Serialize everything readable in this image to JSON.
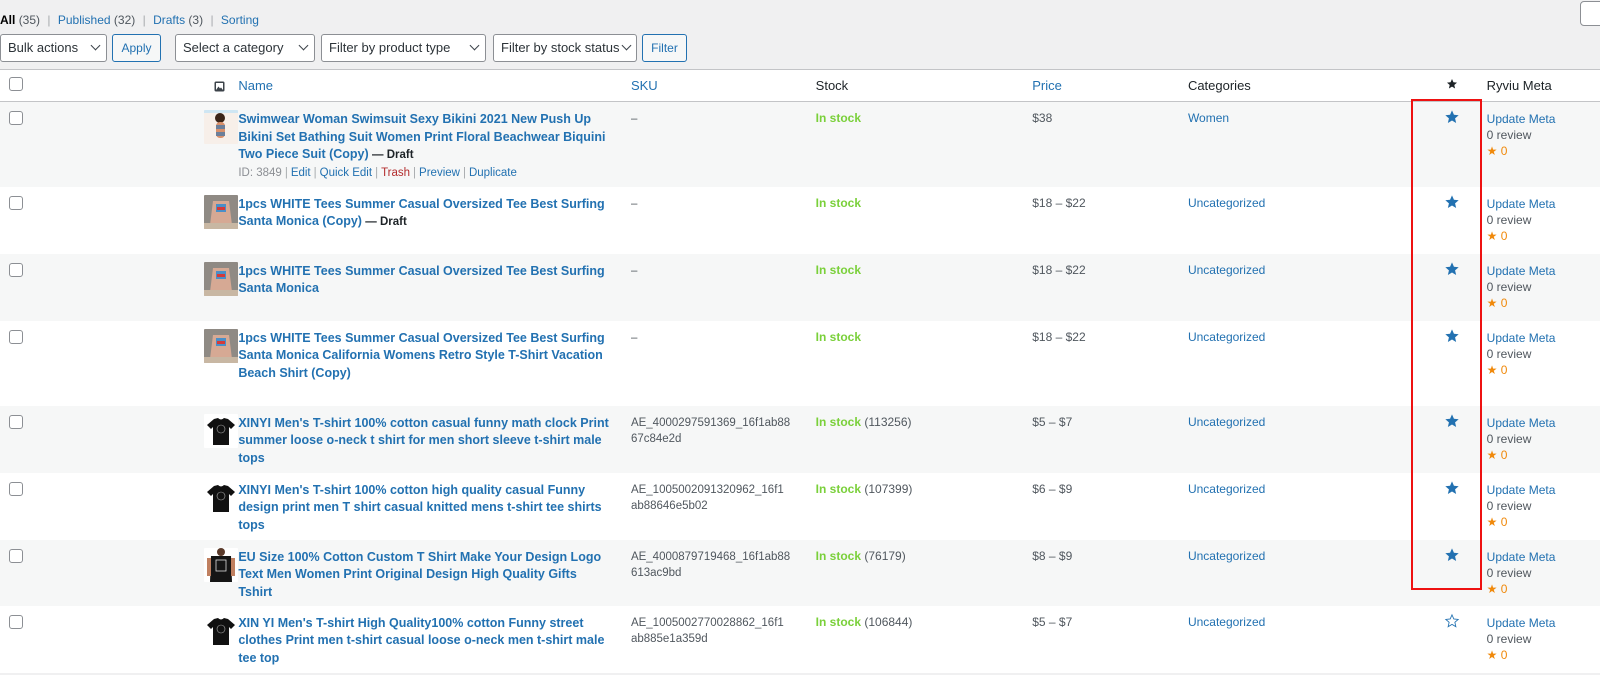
{
  "views": {
    "all": {
      "label": "All",
      "count": "(35)"
    },
    "published": {
      "label": "Published",
      "count": "(32)"
    },
    "drafts": {
      "label": "Drafts",
      "count": "(3)"
    },
    "sorting": {
      "label": "Sorting"
    },
    "separator": "|"
  },
  "toolbar": {
    "bulk_actions": "Bulk actions",
    "apply": "Apply",
    "category": "Select a category",
    "product_type": "Filter by product type",
    "stock_status": "Filter by stock status",
    "filter": "Filter"
  },
  "columns": {
    "name": "Name",
    "sku": "SKU",
    "stock": "Stock",
    "price": "Price",
    "categories": "Categories",
    "featured_icon": "star-icon",
    "ryviu": "Ryviu Meta"
  },
  "colors": {
    "link": "#2271b1",
    "in_stock": "#7ad03a",
    "trash": "#b32d2e",
    "rating_star": "#f0890b",
    "highlight_box": "#ee1111"
  },
  "row_actions": {
    "id": "ID: 3849",
    "edit": "Edit",
    "quick_edit": "Quick Edit",
    "trash": "Trash",
    "preview": "Preview",
    "duplicate": "Duplicate",
    "sep": "|"
  },
  "products": [
    {
      "name": "Swimwear Woman Swimsuit Sexy Bikini 2021 New Push Up Bikini Set Bathing Suit Women Print Floral Beachwear Biquini Two Piece Suit (Copy)",
      "status": "— Draft",
      "sku": "–",
      "stock": "In stock",
      "qty": "",
      "price": "$38",
      "category": "Women",
      "featured": true,
      "update": "Update Meta",
      "reviews": "0 review",
      "rating": "★ 0",
      "thumb": "bikini"
    },
    {
      "name": "1pcs WHITE Tees Summer Casual Oversized Tee Best Surfing Santa Monica (Copy)",
      "status": "— Draft",
      "sku": "–",
      "stock": "In stock",
      "qty": "",
      "price": "$18 – $22",
      "category": "Uncategorized",
      "featured": true,
      "update": "Update Meta",
      "reviews": "0 review",
      "rating": "★ 0",
      "thumb": "tee"
    },
    {
      "name": "1pcs WHITE Tees Summer Casual Oversized Tee Best Surfing Santa Monica",
      "status": "",
      "sku": "–",
      "stock": "In stock",
      "qty": "",
      "price": "$18 – $22",
      "category": "Uncategorized",
      "featured": true,
      "update": "Update Meta",
      "reviews": "0 review",
      "rating": "★ 0",
      "thumb": "tee"
    },
    {
      "name": "1pcs WHITE Tees Summer Casual Oversized Tee Best Surfing Santa Monica California Womens Retro Style T-Shirt Vacation Beach Shirt (Copy)",
      "status": "",
      "sku": "–",
      "stock": "In stock",
      "qty": "",
      "price": "$18 – $22",
      "category": "Uncategorized",
      "featured": true,
      "update": "Update Meta",
      "reviews": "0 review",
      "rating": "★ 0",
      "thumb": "tee"
    },
    {
      "name": "XINYI Men's T-shirt 100% cotton casual funny math clock Print summer loose o-neck t shirt for men short sleeve t-shirt male tops",
      "status": "",
      "sku": "AE_4000297591369_16f1ab8867c84e2d",
      "stock": "In stock",
      "qty": "(113256)",
      "price": "$5 – $7",
      "category": "Uncategorized",
      "featured": true,
      "update": "Update Meta",
      "reviews": "0 review",
      "rating": "★ 0",
      "thumb": "black"
    },
    {
      "name": "XINYI Men's T-shirt 100% cotton high quality casual Funny design print men T shirt casual knitted mens t-shirt tee shirts tops",
      "status": "",
      "sku": "AE_1005002091320962_16f1ab88646e5b02",
      "stock": "In stock",
      "qty": "(107399)",
      "price": "$6 – $9",
      "category": "Uncategorized",
      "featured": true,
      "update": "Update Meta",
      "reviews": "0 review",
      "rating": "★ 0",
      "thumb": "black"
    },
    {
      "name": "EU Size 100% Cotton Custom T Shirt Make Your Design Logo Text Men Women Print Original Design High Quality Gifts Tshirt",
      "status": "",
      "sku": "AE_4000879719468_16f1ab88613ac9bd",
      "stock": "In stock",
      "qty": "(76179)",
      "price": "$8 – $9",
      "category": "Uncategorized",
      "featured": true,
      "update": "Update Meta",
      "reviews": "0 review",
      "rating": "★ 0",
      "thumb": "model"
    },
    {
      "name": "XIN YI Men's T-shirt High Quality100% cotton Funny street clothes Print men t-shirt casual loose o-neck men t-shirt male tee top",
      "status": "",
      "sku": "AE_1005002770028862_16f1ab885e1a359d",
      "stock": "In stock",
      "qty": "(106844)",
      "price": "$5 – $7",
      "category": "Uncategorized",
      "featured": false,
      "update": "Update Meta",
      "reviews": "0 review",
      "rating": "★ 0",
      "thumb": "black"
    }
  ]
}
